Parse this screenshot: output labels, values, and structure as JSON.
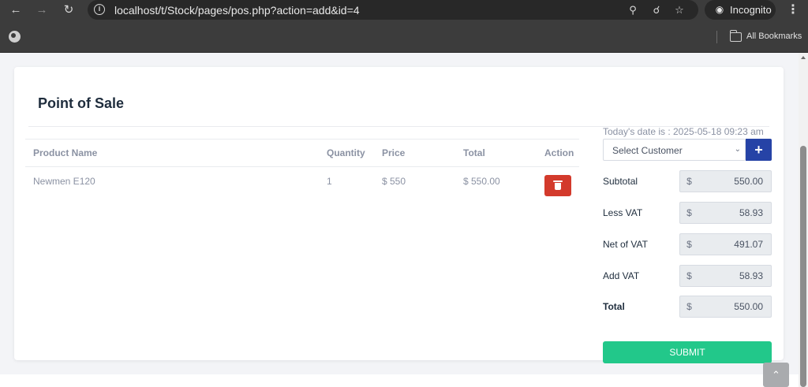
{
  "browser": {
    "url": "localhost/t/Stock/pages/pos.php?action=add&id=4",
    "incognito_label": "Incognito",
    "bookmarks_label": "All Bookmarks"
  },
  "page": {
    "title": "Point of Sale",
    "table": {
      "headers": [
        "Product Name",
        "Quantity",
        "Price",
        "Total",
        "Action"
      ],
      "rows": [
        {
          "product": "Newmen E120",
          "quantity": "1",
          "price": "$ 550",
          "total": "$ 550.00"
        }
      ]
    },
    "date_text": "Today's date is : 2025-05-18 09:23 am",
    "customer_select": {
      "selected": "Select Customer"
    },
    "add_customer_label": "+",
    "summary": [
      {
        "label": "Subtotal",
        "currency": "$",
        "value": "550.00"
      },
      {
        "label": "Less VAT",
        "currency": "$",
        "value": "58.93"
      },
      {
        "label": "Net of VAT",
        "currency": "$",
        "value": "491.07"
      },
      {
        "label": "Add VAT",
        "currency": "$",
        "value": "58.93"
      },
      {
        "label": "Total",
        "currency": "$",
        "value": "550.00"
      }
    ],
    "submit_label": "SUBMIT"
  }
}
